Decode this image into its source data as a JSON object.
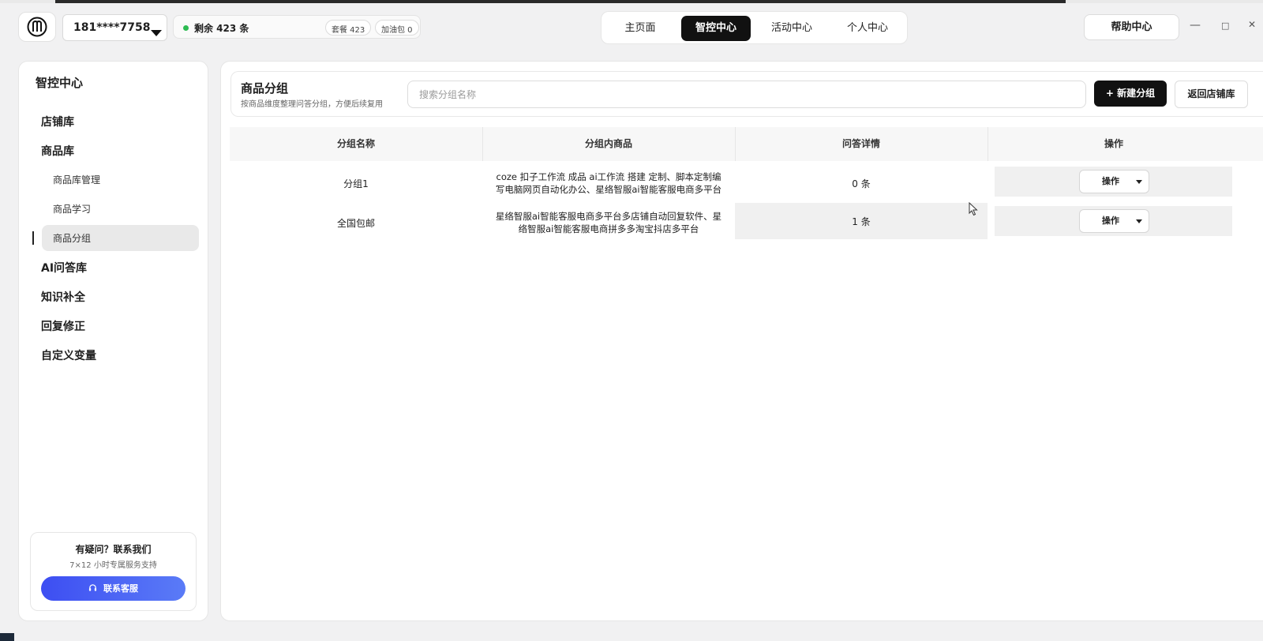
{
  "topbar": {
    "account": "181****7758",
    "remaining": "剩余 423 条",
    "package_chip": "套餐 423",
    "addon_chip": "加油包 0",
    "nav_tabs": [
      {
        "label": "主页面",
        "active": false
      },
      {
        "label": "智控中心",
        "active": true
      },
      {
        "label": "活动中心",
        "active": false
      },
      {
        "label": "个人中心",
        "active": false
      }
    ],
    "help_label": "帮助中心",
    "window_controls": {
      "minimize": "—",
      "maximize": "□",
      "close": "✕"
    }
  },
  "sidebar": {
    "title": "智控中心",
    "items": [
      {
        "label": "店铺库",
        "level": 1
      },
      {
        "label": "商品库",
        "level": 1
      },
      {
        "label": "商品库管理",
        "level": 2
      },
      {
        "label": "商品学习",
        "level": 2
      },
      {
        "label": "商品分组",
        "level": 2,
        "active": true
      },
      {
        "label": "AI问答库",
        "level": 1
      },
      {
        "label": "知识补全",
        "level": 1
      },
      {
        "label": "回复修正",
        "level": 1
      },
      {
        "label": "自定义变量",
        "level": 1
      }
    ],
    "contact": {
      "question": "有疑问？联系我们",
      "subtitle": "7×12 小时专属服务支持",
      "button_label": "联系客服",
      "button_icon": "headset-icon"
    }
  },
  "main": {
    "title": "商品分组",
    "subtitle": "按商品维度整理问答分组，方便后续复用",
    "search_placeholder": "搜索分组名称",
    "new_group_label": "+ 新建分组",
    "back_label": "返回店铺库",
    "table": {
      "headers": [
        "分组名称",
        "分组内商品",
        "问答详情",
        "操作"
      ],
      "rows": [
        {
          "name": "分组1",
          "goods": "coze 扣子工作流 成品 ai工作流 搭建 定制、脚本定制编写电脑网页自动化办公、星络智服ai智能客服电商多平台",
          "qa": "0 条",
          "op": "操作"
        },
        {
          "name": "全国包邮",
          "goods": "星络智服ai智能客服电商多平台多店铺自动回复软件、星络智服ai智能客服电商拼多多淘宝抖店多平台",
          "qa": "1 条",
          "op": "操作"
        }
      ]
    }
  },
  "colors": {
    "accent_dark": "#111111",
    "status_green": "#2dbb52",
    "contact_gradient_start": "#3d4ef2",
    "contact_gradient_end": "#5a7bf7"
  }
}
